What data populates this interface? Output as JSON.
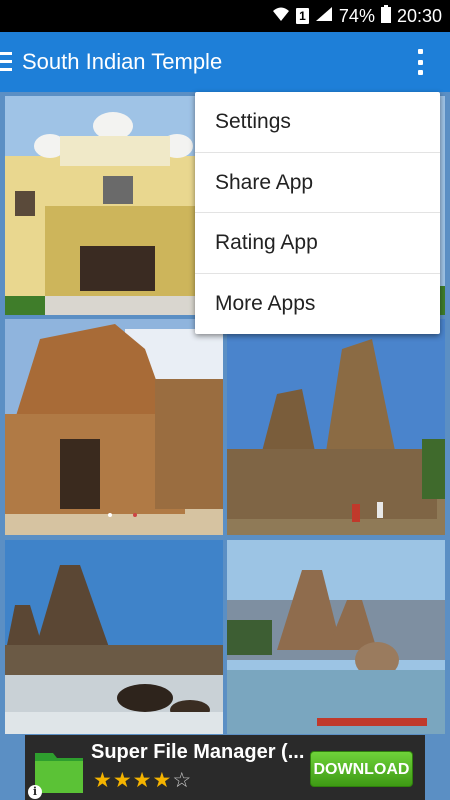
{
  "status_bar": {
    "sim_label": "1",
    "battery": "74%",
    "time": "20:30",
    "icons": [
      "wifi-icon",
      "signal-icon",
      "battery-icon"
    ]
  },
  "app_bar": {
    "title": "South Indian Temple",
    "color": "#1e7fd8"
  },
  "gallery": {
    "items": [
      {
        "name": "white-palace-temple"
      },
      {
        "name": "gopuram-temple"
      },
      {
        "name": "shore-temple-closeup"
      },
      {
        "name": "shore-temple-seaside"
      },
      {
        "name": "shore-temple-rocks"
      }
    ]
  },
  "menu": {
    "items": [
      {
        "label": "Settings"
      },
      {
        "label": "Share App"
      },
      {
        "label": "Rating App"
      },
      {
        "label": "More Apps"
      }
    ]
  },
  "ad": {
    "title": "Super File Manager (...",
    "rating": 4,
    "rating_max": 5,
    "stars_filled": "★★★★",
    "stars_empty": "☆",
    "button_label": "DOWNLOAD",
    "info_label": "i",
    "button_color": "#4caf1a"
  }
}
